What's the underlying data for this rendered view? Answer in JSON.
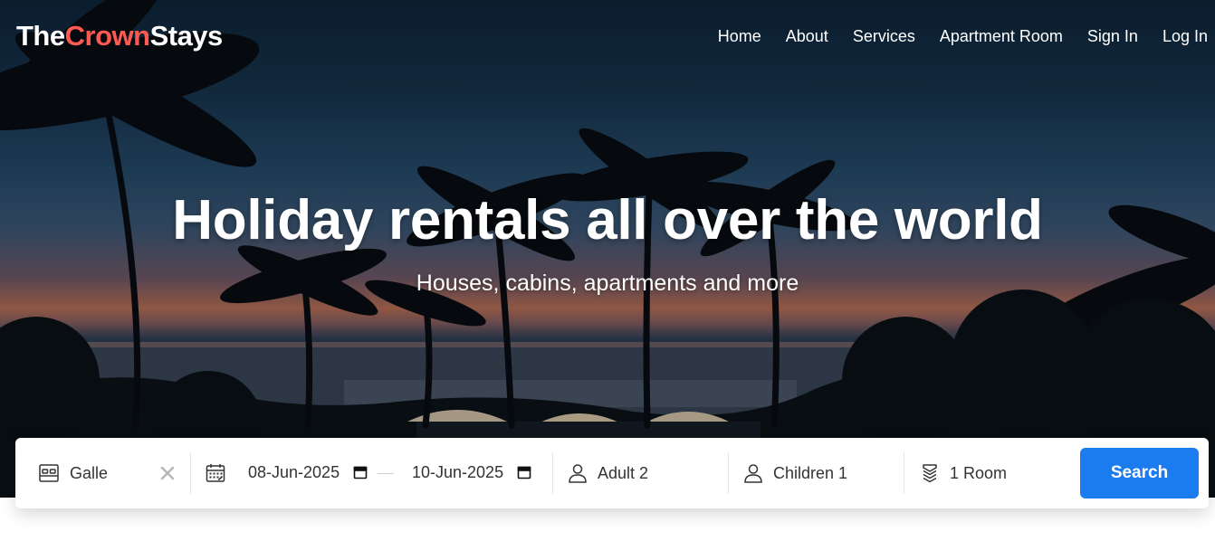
{
  "brand": {
    "prefix": "The",
    "accent": "Crown",
    "suffix": "Stays",
    "accent_color": "#ff5a52"
  },
  "nav": [
    {
      "label": "Home"
    },
    {
      "label": "About"
    },
    {
      "label": "Services"
    },
    {
      "label": "Apartment Room"
    },
    {
      "label": "Sign In"
    },
    {
      "label": "Log In"
    }
  ],
  "hero": {
    "headline": "Holiday rentals all over the world",
    "subheadline": "Houses, cabins, apartments and more"
  },
  "search": {
    "destination": {
      "value": "Galle",
      "icon": "bed-icon",
      "clear_icon": "close-icon"
    },
    "dates": {
      "icon": "calendar-icon",
      "checkin": "08-Jun-2025",
      "checkout": "10-Jun-2025"
    },
    "adults": {
      "icon": "person-icon",
      "label": "Adult 2"
    },
    "children": {
      "icon": "person-icon",
      "label": "Children 1"
    },
    "rooms": {
      "icon": "layers-icon",
      "label": "1 Room"
    },
    "button_label": "Search",
    "button_color": "#1b7cf0"
  }
}
